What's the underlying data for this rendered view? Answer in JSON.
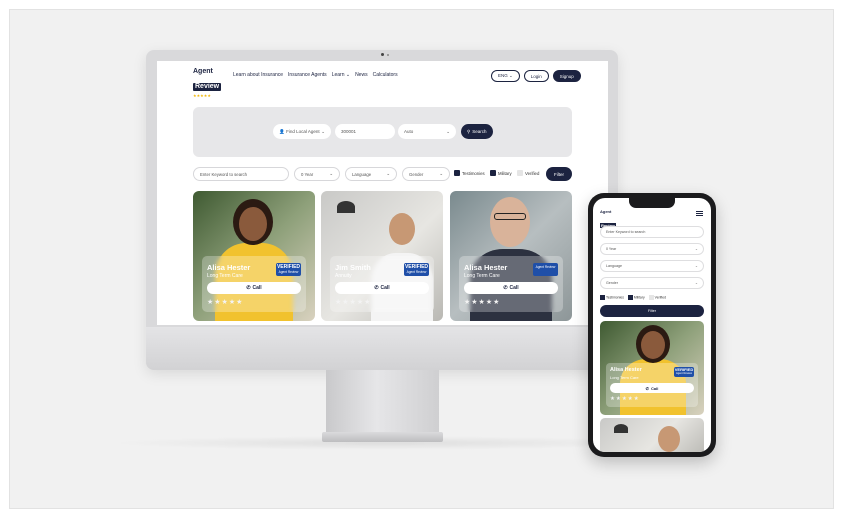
{
  "brand": {
    "logo_line1": "Agent",
    "logo_line2": "Review",
    "logo_stars": "★★★★★"
  },
  "nav": {
    "links": [
      "Learn about Insurance",
      "Insurance Agents",
      "Learn ⌄",
      "News",
      "Calculators"
    ],
    "lang": "ENG ⌄",
    "login": "Login",
    "signup": "Signup"
  },
  "search": {
    "agent_select": "Find Local Agent",
    "zip_value": "300001",
    "type_select": "Auto",
    "button": "Search"
  },
  "filters": {
    "keyword_placeholder": "Enter Keyword to search",
    "years": "0 Year",
    "language": "Language",
    "gender": "Gender",
    "check1": "Testimonies",
    "check2": "Military",
    "check3": "Verified",
    "button": "Filter"
  },
  "cards": [
    {
      "name": "Alisa Hester",
      "role": "Long Term Care",
      "badge_top": "VERIFIED",
      "badge_bottom": "Agent Review",
      "call": "Call",
      "stars": "★★★★★"
    },
    {
      "name": "Jim Smith",
      "role": "Annuity",
      "badge_top": "VERIFIED",
      "badge_bottom": "Agent Review",
      "call": "Call",
      "stars": "★★★★★"
    },
    {
      "name": "Alisa Hester",
      "role": "Long Term Care",
      "badge_top": "",
      "badge_bottom": "Agent Review",
      "call": "Call",
      "stars": "★★★★★"
    }
  ],
  "mobile": {
    "keyword_placeholder": "Enter Keyword to search",
    "years": "0 Year",
    "language": "Language",
    "gender": "Gender",
    "check1": "Testimonies",
    "check2": "Military",
    "check3": "Verified",
    "button": "Filter",
    "card": {
      "name": "Alisa Hester",
      "role": "Long Term Care",
      "badge_top": "VERIFIED",
      "badge_bottom": "Agent Review",
      "call": "Call",
      "stars": "★★★★★"
    }
  },
  "colors": {
    "navy": "#1c2340",
    "accent_blue": "#1f4fa8",
    "star": "#f2b705"
  }
}
